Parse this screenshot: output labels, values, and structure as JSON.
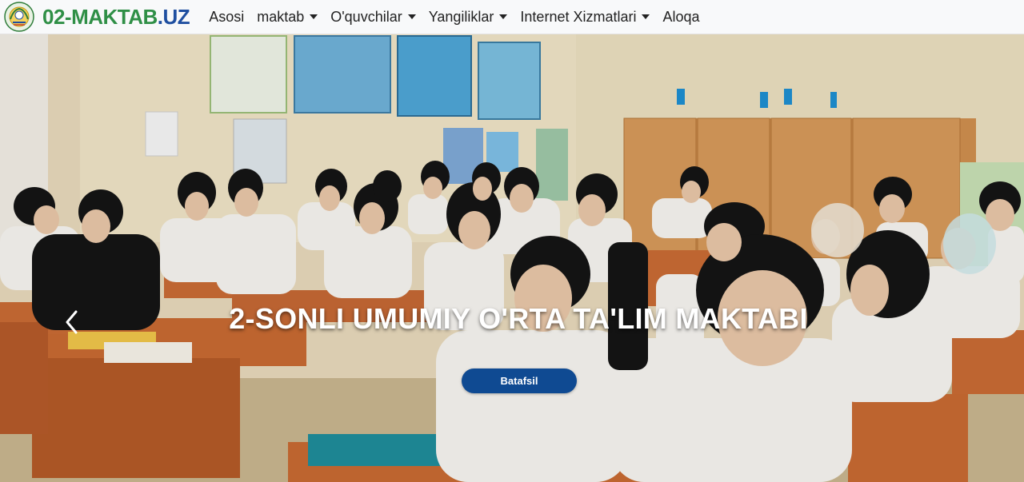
{
  "brand": {
    "main": "02-MAKTAB",
    "tld": ".UZ"
  },
  "nav": {
    "items": [
      {
        "label": "Asosi",
        "dropdown": false
      },
      {
        "label": "maktab",
        "dropdown": true
      },
      {
        "label": "O'quvchilar",
        "dropdown": true
      },
      {
        "label": "Yangiliklar",
        "dropdown": true
      },
      {
        "label": "Internet Xizmatlari",
        "dropdown": true
      },
      {
        "label": "Aloqa",
        "dropdown": false
      }
    ]
  },
  "hero": {
    "caption": "2-SONLI UMUMIY O'RTA TA'LIM MAKTABI",
    "button_label": "Batafsil",
    "button_color": "#0f4a92"
  },
  "icons": {
    "emblem": "uzbekistan-emblem-icon",
    "prev": "chevron-left-icon",
    "caret": "caret-down-icon"
  }
}
